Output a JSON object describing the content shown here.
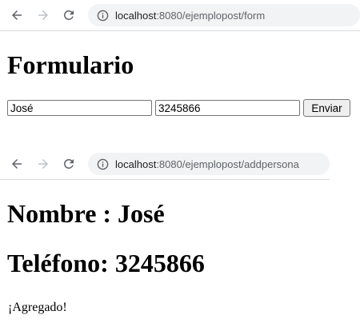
{
  "form_window": {
    "nav": {
      "back_icon": "arrow-left-icon",
      "forward_icon": "arrow-right-icon",
      "reload_icon": "reload-icon"
    },
    "address": {
      "host": "localhost",
      "rest": ":8080/ejemplopost/form",
      "icon": "info-icon"
    },
    "heading": "Formulario",
    "name_value": "José",
    "phone_value": "3245866",
    "submit_label": "Enviar"
  },
  "result_window": {
    "nav": {
      "back_icon": "arrow-left-icon",
      "forward_icon": "arrow-right-icon",
      "reload_icon": "reload-icon"
    },
    "address": {
      "host": "localhost",
      "rest": ":8080/ejemplopost/addpersona",
      "icon": "info-icon"
    },
    "name_heading": "Nombre : José",
    "phone_heading": "Teléfono: 3245866",
    "status": "¡Agregado!"
  },
  "colors": {
    "icon_active": "#5f6368",
    "icon_disabled": "#bdc1c6",
    "address_bg": "#f1f3f4"
  }
}
